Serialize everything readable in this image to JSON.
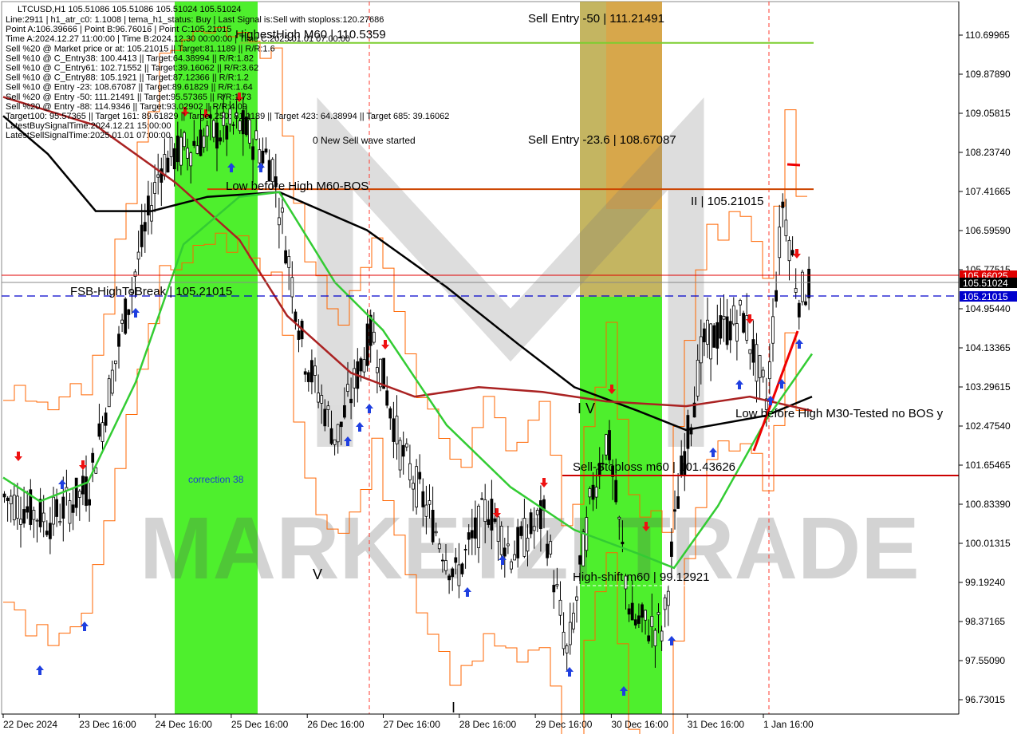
{
  "chart_data": {
    "type": "candlestick",
    "title": "LTCUSD,H1",
    "ohlc_header": "105.51086 105.51086 105.51024 105.51024",
    "info_lines": [
      "Line:2911 | h1_atr_c0: 1.1008 | tema_h1_status: Buy | Last Signal is:Sell with stoploss:120.27686",
      "Point A:106.39666 | Point B:96.76016 | Point C:105.21015",
      "Time A:2024.12.27 11:00:00 | Time B:2024.12.30 00:00:00 | Time C:2025.01.01 07:00:00",
      "Sell %20 @ Market price or at: 105.21015 || Target:81.1189 || R/R:1.6",
      "Sell %10 @ C_Entry38: 100.4413 || Target:64.38994 || R/R:1.82",
      "Sell %10 @ C_Entry61: 102.71552 || Target:39.16062 || R/R:3.62",
      "Sell %10 @ C_Entry88: 105.1921 || Target:87.12366 || R/R:1.2",
      "Sell %10 @ Entry -23: 108.67087 || Target:89.61829 || R/R:1.64",
      "Sell %20 @ Entry -50: 111.21491 || Target:95.57365 || R/R:1.73",
      "Sell %20 @ Entry -88: 114.9346 || Target:93.02902 || R/R:4.09",
      "Target100: 95.57365 || Target 161: 89.61829 || Target 250: 81.1189 || Target 423: 64.38994 || Target 685: 39.16062",
      "LatestBuySignalTime:2024.12.21 15:00:00",
      "LatestSellSignalTime:2025.01.01 07:00:00"
    ],
    "y_ticks": [
      "110.69965",
      "109.87890",
      "109.05815",
      "108.23740",
      "107.41665",
      "106.59590",
      "105.77515",
      "104.95440",
      "104.13365",
      "103.29615",
      "102.47540",
      "101.65465",
      "100.83390",
      "100.01315",
      "99.19240",
      "98.37165",
      "97.55090",
      "96.73015"
    ],
    "y_range": [
      96.73015,
      110.69965
    ],
    "x_ticks": [
      "22 Dec 2024",
      "23 Dec 16:00",
      "24 Dec 16:00",
      "25 Dec 16:00",
      "26 Dec 16:00",
      "27 Dec 16:00",
      "28 Dec 16:00",
      "29 Dec 16:00",
      "30 Dec 16:00",
      "31 Dec 16:00",
      "1 Jan 16:00"
    ],
    "price_tags": [
      {
        "value": 105.66025,
        "text": "105.66025",
        "bg": "#e00000"
      },
      {
        "value": 105.51024,
        "text": "105.51024",
        "bg": "#000000"
      },
      {
        "value": 105.21015,
        "text": "105.21015",
        "bg": "#0000cc"
      }
    ],
    "levels": [
      {
        "text": "Sell Entry -50 | 111.21491",
        "color": "#000000"
      },
      {
        "text": "HighestHigh   M60 | 110.5359",
        "value": 110.5359,
        "color": "#7ccd2f"
      },
      {
        "text": "Sell Entry -23.6 | 108.67087",
        "color": "#000000"
      },
      {
        "text": "Low before High   M60-BOS",
        "value": 107.46,
        "color": "#cc4400"
      },
      {
        "text": "II | 105.21015",
        "value": 107.46,
        "color": "#cc4400"
      },
      {
        "text": "FSB-HighToBreak | 105.21015",
        "value": 105.21015,
        "color": "#0000cc"
      },
      {
        "text": "Sell-Stoploss m60 | 101.43626",
        "value": 101.43626,
        "color": "#cc0000"
      },
      {
        "text": "High-shift m60 | 99.12921",
        "value": 99.12921,
        "color": "#ffffff"
      },
      {
        "text": "Low before High   M30-Tested no BOS y",
        "color": "#000000"
      }
    ],
    "labels": [
      {
        "text": "0 New Sell wave started"
      },
      {
        "text": "correction 38",
        "color": "#1a3fd0"
      },
      {
        "text": "I V"
      },
      {
        "text": "V"
      },
      {
        "text": "I"
      }
    ],
    "watermark": "MARKETZI TRADE",
    "colors": {
      "bull": "#000000",
      "bear": "#000000",
      "ema_green": "#33cc33",
      "ma_black": "#000000",
      "ma_brown": "#aa2222",
      "band": "#ff6600"
    }
  }
}
